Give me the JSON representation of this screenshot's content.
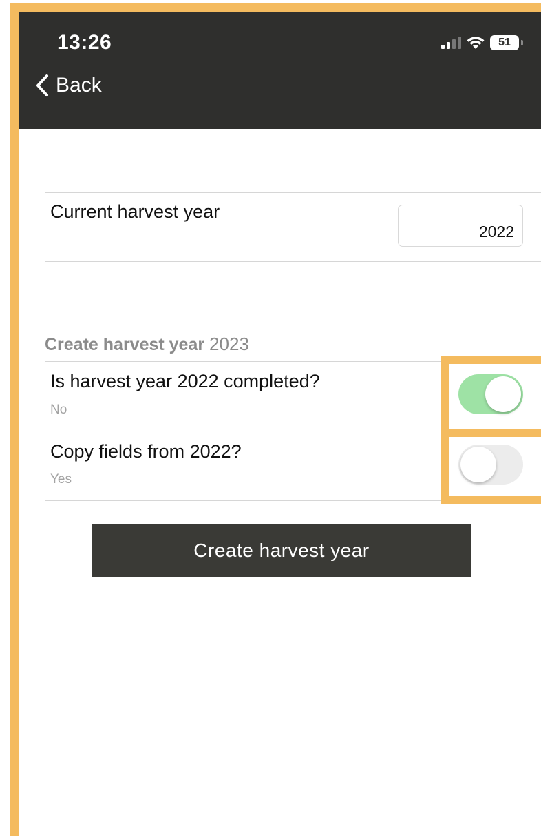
{
  "status_bar": {
    "time": "13:26",
    "battery": "51",
    "icons": [
      "signal-icon",
      "wifi-icon",
      "battery-icon"
    ]
  },
  "nav": {
    "back_label": "Back"
  },
  "current_year": {
    "label": "Current harvest year",
    "value": "2022"
  },
  "create_section": {
    "title_bold": "Create harvest year",
    "title_year": "2023",
    "completed": {
      "label": "Is harvest year 2022 completed?",
      "sub": "No",
      "toggle_on": true
    },
    "copy_fields": {
      "label": "Copy fields from 2022?",
      "sub": "Yes",
      "toggle_on": false
    },
    "button_label": "Create harvest year"
  },
  "colors": {
    "header_bg": "#2f2f2d",
    "highlight": "#f4bb5f",
    "toggle_on": "#9ee2a5",
    "toggle_off": "#ececec",
    "button_bg": "#3a3a36"
  }
}
